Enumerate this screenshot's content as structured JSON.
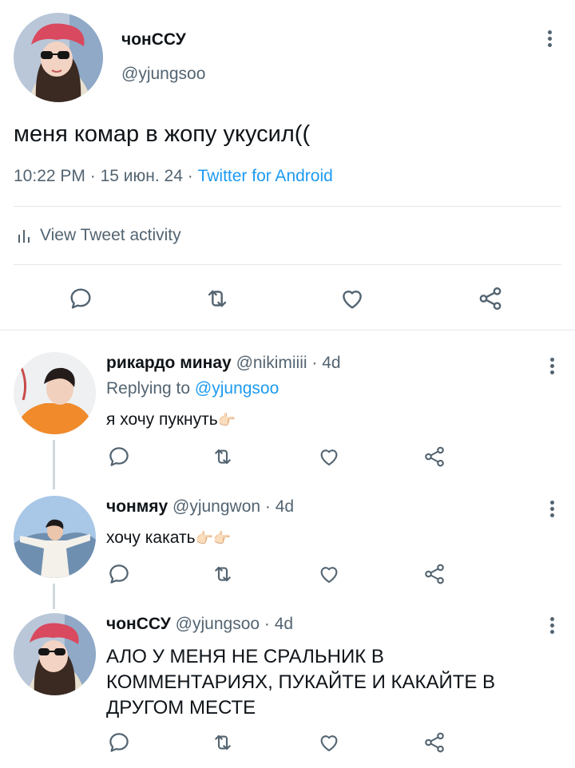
{
  "main": {
    "author_name": "чонССУ",
    "author_handle": "@yjungsoo",
    "text": "меня комар в жопу укусил((",
    "time": "10:22 PM",
    "date": "15 июн. 24",
    "client": "Twitter for Android",
    "activity_label": "View Tweet activity"
  },
  "replies": [
    {
      "name": "рикардо минау",
      "handle": "@nikimiiii",
      "age": "4d",
      "replying_prefix": "Replying to",
      "replying_handle": "@yjungsoo",
      "text": "я хочу пукнуть",
      "emoji": "👉🏻"
    },
    {
      "name": "чонмяу",
      "handle": "@yjungwon",
      "age": "4d",
      "text": "хочу какать",
      "emoji": "👉🏻👉🏻"
    },
    {
      "name": "чонССУ",
      "handle": "@yjungsoo",
      "age": "4d",
      "text_lines": [
        "АЛО У МЕНЯ НЕ СРАЛЬНИК В",
        "КОММЕНТАРИЯХ, ПУКАЙТЕ И КАКАЙТЕ В",
        "ДРУГОМ МЕСТЕ"
      ]
    }
  ],
  "icons": {
    "reply": "reply-icon",
    "retweet": "retweet-icon",
    "like": "like-icon",
    "share": "share-icon",
    "more": "more-icon",
    "stats": "stats-icon"
  },
  "colors": {
    "accent": "#1d9bf0",
    "secondary_text": "#536471",
    "divider": "#e4e8eb"
  },
  "separator": "·"
}
